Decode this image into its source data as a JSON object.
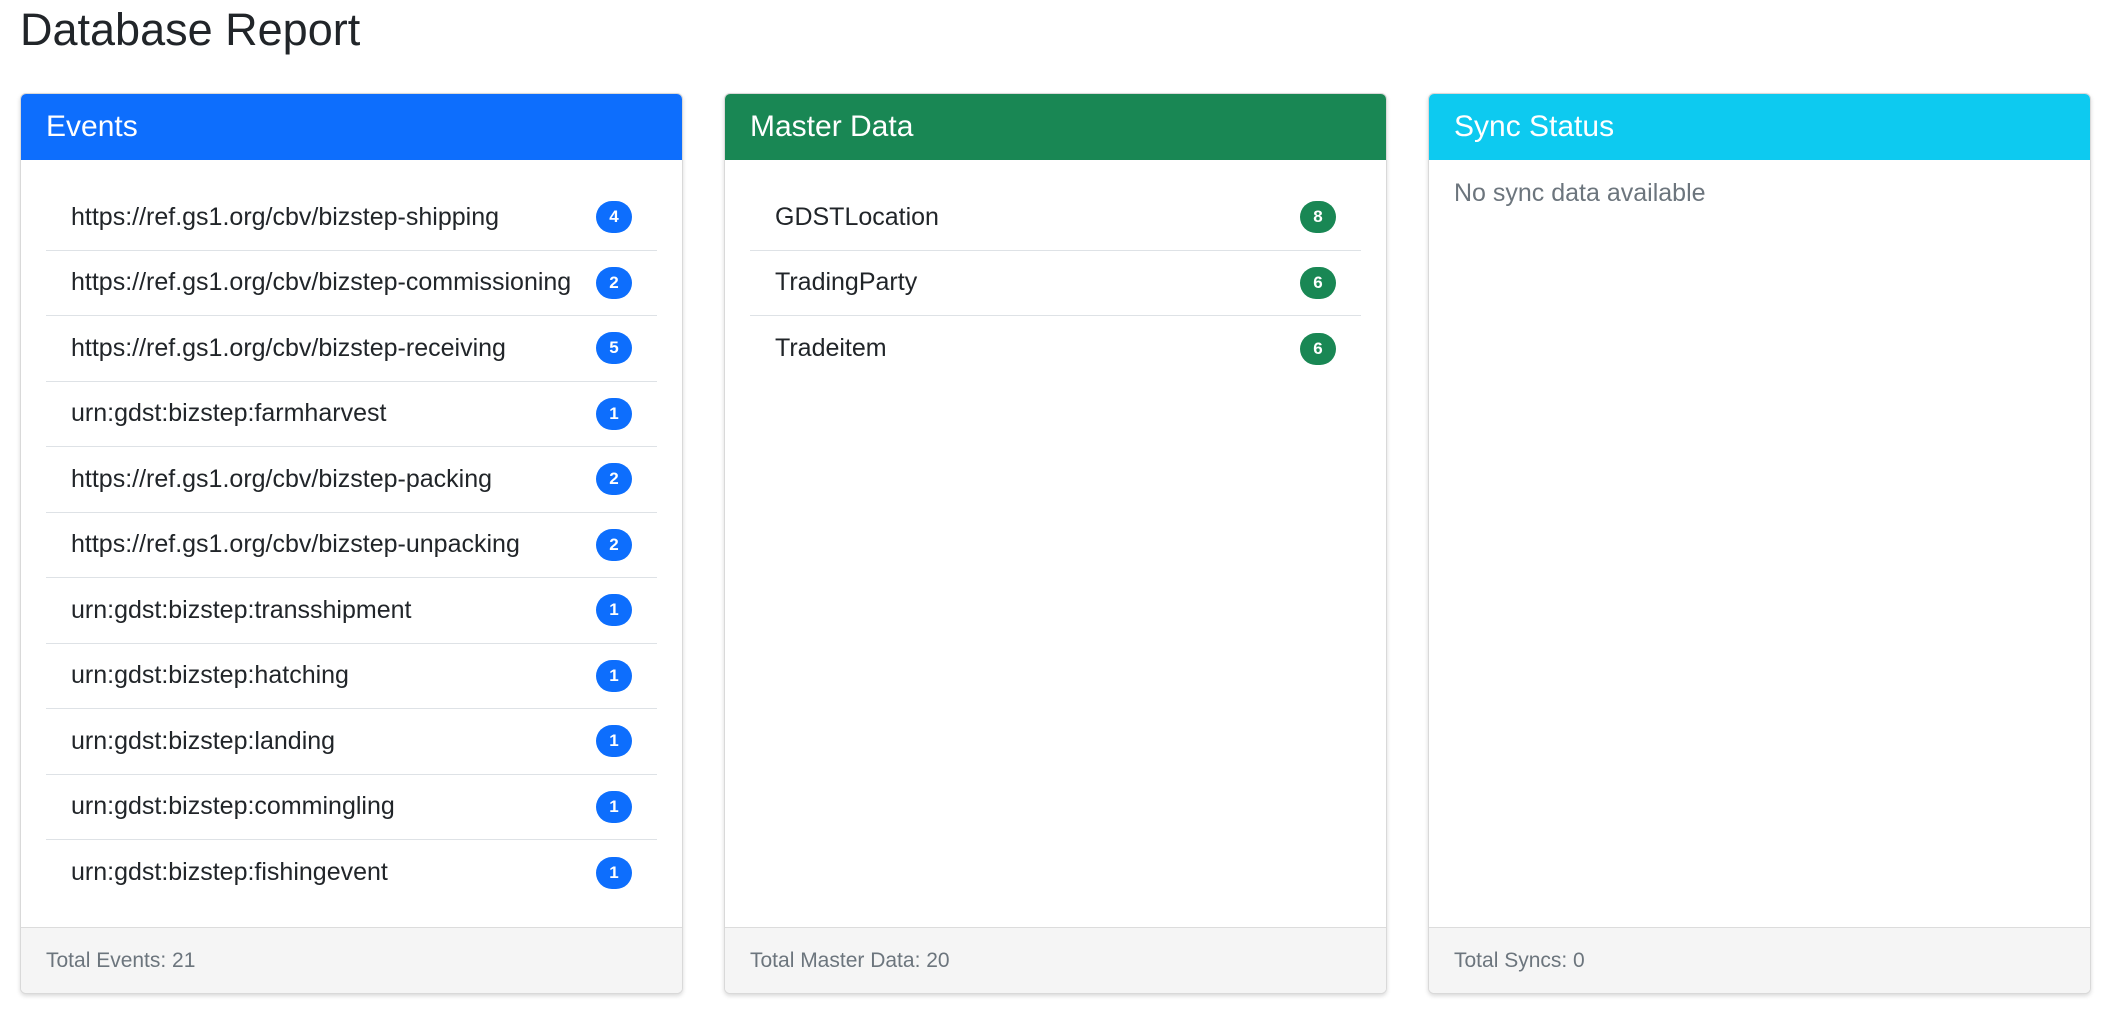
{
  "page": {
    "title": "Database Report"
  },
  "colors": {
    "events_header": "#0d6efd",
    "master_header": "#198754",
    "sync_header": "#0dcaf0",
    "events_badge": "#0d6efd",
    "master_badge": "#198754"
  },
  "events": {
    "title": "Events",
    "items": [
      {
        "label": "https://ref.gs1.org/cbv/bizstep-shipping",
        "count": "4"
      },
      {
        "label": "https://ref.gs1.org/cbv/bizstep-commissioning",
        "count": "2"
      },
      {
        "label": "https://ref.gs1.org/cbv/bizstep-receiving",
        "count": "5"
      },
      {
        "label": "urn:gdst:bizstep:farmharvest",
        "count": "1"
      },
      {
        "label": "https://ref.gs1.org/cbv/bizstep-packing",
        "count": "2"
      },
      {
        "label": "https://ref.gs1.org/cbv/bizstep-unpacking",
        "count": "2"
      },
      {
        "label": "urn:gdst:bizstep:transshipment",
        "count": "1"
      },
      {
        "label": "urn:gdst:bizstep:hatching",
        "count": "1"
      },
      {
        "label": "urn:gdst:bizstep:landing",
        "count": "1"
      },
      {
        "label": "urn:gdst:bizstep:commingling",
        "count": "1"
      },
      {
        "label": "urn:gdst:bizstep:fishingevent",
        "count": "1"
      }
    ],
    "footer": "Total Events: 21"
  },
  "master_data": {
    "title": "Master Data",
    "items": [
      {
        "label": "GDSTLocation",
        "count": "8"
      },
      {
        "label": "TradingParty",
        "count": "6"
      },
      {
        "label": "Tradeitem",
        "count": "6"
      }
    ],
    "footer": "Total Master Data: 20"
  },
  "sync_status": {
    "title": "Sync Status",
    "empty_text": "No sync data available",
    "footer": "Total Syncs: 0"
  }
}
